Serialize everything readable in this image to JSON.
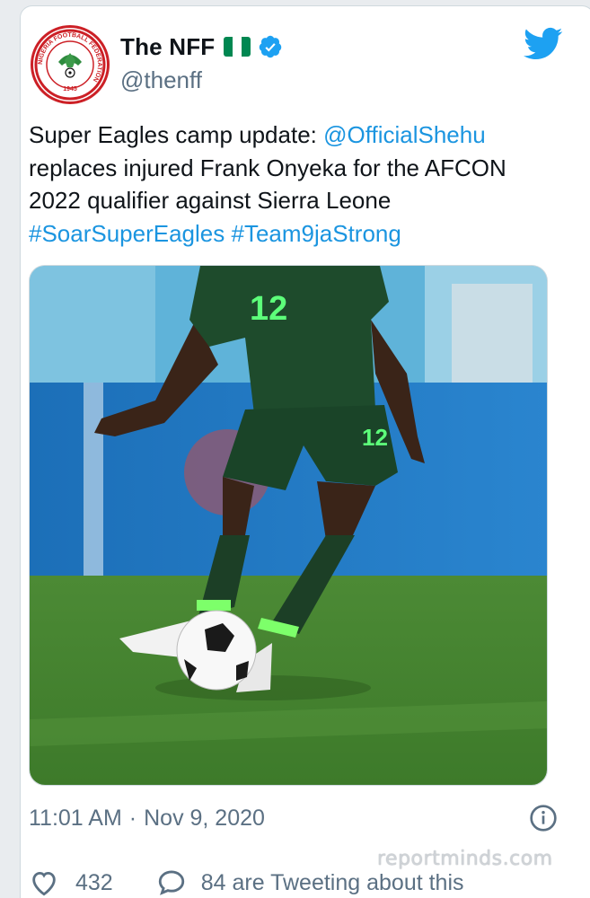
{
  "tweet": {
    "display_name": "The NFF",
    "handle": "@thenff",
    "text_before_mention": "Super Eagles camp update: ",
    "mention": "@OfficialShehu",
    "text_after_mention": " replaces injured Frank Onyeka for the AFCON 2022 qualifier against Sierra Leone",
    "hashtags": [
      "#SoarSuperEagles",
      "#Team9jaStrong"
    ],
    "time": "11:01 AM",
    "separator": "·",
    "date": "Nov 9, 2020",
    "likes": "432",
    "tweeting_text": "84 are Tweeting about this"
  },
  "avatar": {
    "logo_ring_text": "NIGERIA FOOTBALL FEDERATION",
    "logo_year": "1945"
  },
  "media": {
    "jersey_number": "12"
  },
  "watermark": "reportminds.com",
  "icons": {
    "verified": "verified-badge-icon",
    "twitter": "twitter-bird-icon",
    "info": "info-icon",
    "like": "heart-icon",
    "reply": "speech-bubble-icon",
    "flag": "nigeria-flag-icon"
  },
  "colors": {
    "link": "#1b95e0",
    "twitter_blue": "#1da1f2",
    "flag_green": "#008751",
    "secondary_text": "#5b7083"
  }
}
